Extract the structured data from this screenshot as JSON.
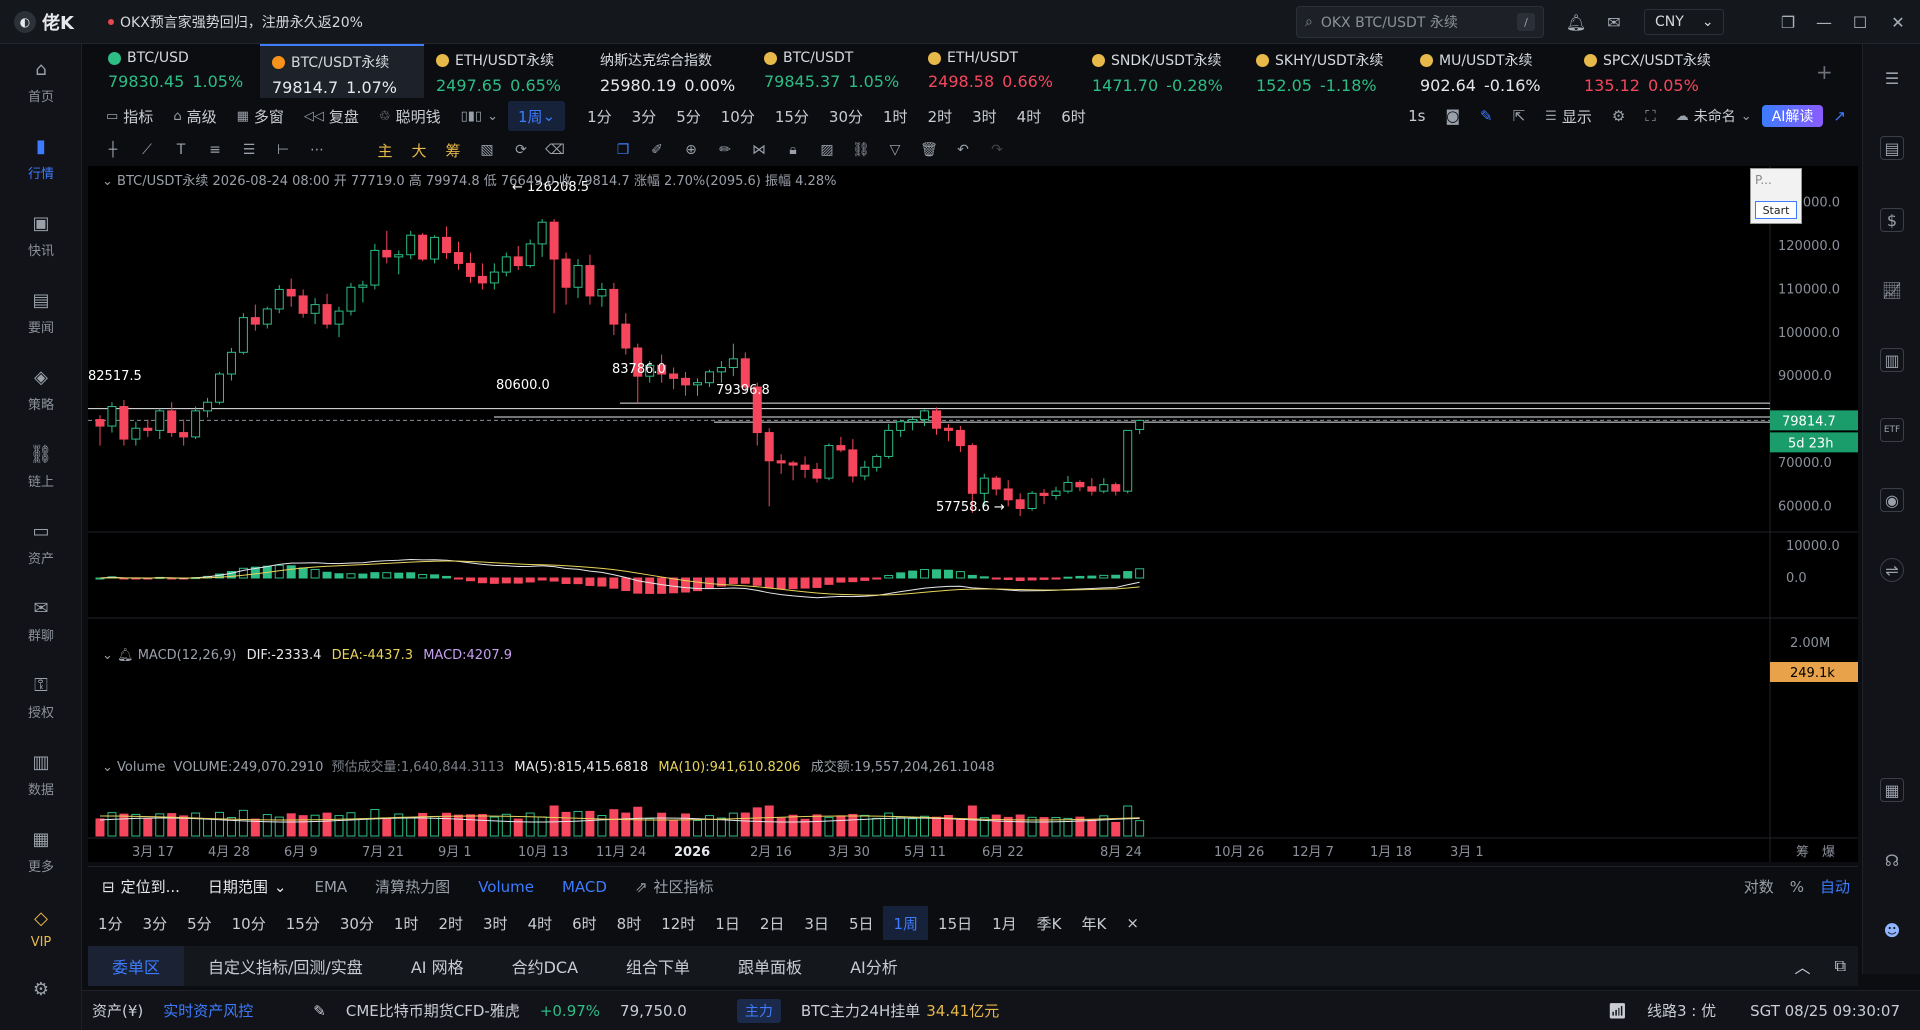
{
  "app": {
    "name": "佬K"
  },
  "announcement": "OKX预言家强势回归，注册永久返20%",
  "search": {
    "placeholder": "OKX BTC/USDT 永续",
    "shortcut": "/"
  },
  "currency": "CNY",
  "sidebar": [
    {
      "label": "首页",
      "icon": "home-icon"
    },
    {
      "label": "行情",
      "icon": "chart-bars-icon",
      "active": true
    },
    {
      "label": "快讯",
      "icon": "news-icon"
    },
    {
      "label": "要闻",
      "icon": "article-icon"
    },
    {
      "label": "策略",
      "icon": "robot-icon"
    },
    {
      "label": "链上",
      "icon": "chain-icon"
    },
    {
      "label": "资产",
      "icon": "wallet-icon"
    },
    {
      "label": "群聊",
      "icon": "chat-icon"
    },
    {
      "label": "授权",
      "icon": "key-icon"
    },
    {
      "label": "数据",
      "icon": "data-icon"
    },
    {
      "label": "更多",
      "icon": "grid-icon"
    },
    {
      "label": "VIP",
      "icon": "vip-icon",
      "vip": true
    }
  ],
  "tickers": [
    {
      "name": "BTC/USD",
      "price": "79830.45",
      "change": "1.05%",
      "color": "#2ebd85",
      "coin": "#2ebd85",
      "dir": "up"
    },
    {
      "name": "BTC/USDT永续",
      "price": "79814.7",
      "change": "1.07%",
      "color": "#f7931a",
      "coin": "#f7931a",
      "dir": "white",
      "active": true
    },
    {
      "name": "ETH/USDT永续",
      "price": "2497.65",
      "change": "0.65%",
      "coin": "#e7b84a",
      "dir": "up"
    },
    {
      "name": "纳斯达克综合指数",
      "price": "25980.19",
      "change": "0.00%",
      "coin": "",
      "dir": "white"
    },
    {
      "name": "BTC/USDT",
      "price": "79845.37",
      "change": "1.05%",
      "coin": "#e7b84a",
      "dir": "up"
    },
    {
      "name": "ETH/USDT",
      "price": "2498.58",
      "change": "0.66%",
      "coin": "#e7b84a",
      "dir": "down"
    },
    {
      "name": "SNDK/USDT永续",
      "price": "1471.70",
      "change": "-0.28%",
      "coin": "#e7b84a",
      "dir": "up"
    },
    {
      "name": "SKHY/USDT永续",
      "price": "152.05",
      "change": "-1.18%",
      "coin": "#e7b84a",
      "dir": "up"
    },
    {
      "name": "MU/USDT永续",
      "price": "902.64",
      "change": "-0.16%",
      "coin": "#e7b84a",
      "dir": "white"
    },
    {
      "name": "SPCX/USDT永续",
      "price": "135.12",
      "change": "0.05%",
      "coin": "#e7b84a",
      "dir": "down"
    }
  ],
  "toolbar1": {
    "items": [
      "指标",
      "高级",
      "多窗",
      "复盘",
      "聪明钱"
    ],
    "interval": "1周",
    "timeframes": [
      "1分",
      "3分",
      "5分",
      "10分",
      "15分",
      "30分",
      "1时",
      "2时",
      "3时",
      "4时",
      "6时"
    ],
    "right_1s": "1s",
    "display": "显示",
    "layout_name": "未命名",
    "ai_label": "AI解读"
  },
  "toolbar2": {
    "text_tools": [
      "主",
      "大",
      "筹"
    ]
  },
  "chart": {
    "info": "BTC/USDT永续 2026-08-24 08:00 开 77719.0 高 79974.8 低 76649.0 收 79814.7 涨幅 2.70%(2095.6) 振幅 4.28%",
    "macd_label": "MACD(12,26,9)",
    "macd_dif": "DIF:-2333.4",
    "macd_dea": "DEA:-4437.3",
    "macd_val": "MACD:4207.9",
    "vol_label": "Volume",
    "vol_value": "VOLUME:249,070.2910",
    "vol_est": "预估成交量:1,640,844.3113",
    "vol_ma5": "MA(5):815,415.6818",
    "vol_ma10": "MA(10):941,610.8206",
    "vol_turnover": "成交额:19,557,204,261.1048",
    "price_labels": [
      "130000.0",
      "120000.0",
      "110000.0",
      "100000.0",
      "90000.0",
      "70000.0",
      "60000.0"
    ],
    "macd_axis": [
      "10000.0",
      "0.0"
    ],
    "vol_axis": [
      "2.00M"
    ],
    "current_price": "79814.7",
    "countdown": "5d 23h",
    "vol_current": "249.1k",
    "annotations": [
      "← 126208.5",
      "82517.5",
      "80600.0",
      "83786.0",
      "79396.8",
      "57758.6 →"
    ],
    "x_labels": [
      "3月 17",
      "4月 28",
      "6月 9",
      "7月 21",
      "9月 1",
      "10月 13",
      "11月 24",
      "2026",
      "2月 16",
      "3月 30",
      "5月 11",
      "6月 22",
      "8月 24",
      "10月 26",
      "12月 7",
      "1月 18",
      "3月 1"
    ],
    "x_right": [
      "筹",
      "爆"
    ],
    "popup_text": "P...",
    "popup_button": "Start"
  },
  "chart_data": {
    "type": "candlestick",
    "interval": "1周",
    "ylim": [
      55000,
      132000
    ],
    "candles": [
      [
        80000,
        81000,
        74000,
        78500
      ],
      [
        78500,
        84000,
        77000,
        83000
      ],
      [
        83000,
        84500,
        74000,
        75500
      ],
      [
        75500,
        79500,
        74000,
        78000
      ],
      [
        78000,
        80000,
        76000,
        77500
      ],
      [
        77500,
        82500,
        75500,
        82000
      ],
      [
        82000,
        84000,
        76000,
        77000
      ],
      [
        77000,
        80000,
        74000,
        76000
      ],
      [
        76000,
        83000,
        75500,
        82000
      ],
      [
        82000,
        85000,
        80500,
        84000
      ],
      [
        84000,
        91000,
        83500,
        90500
      ],
      [
        90500,
        96500,
        89000,
        95500
      ],
      [
        95500,
        104500,
        95000,
        103500
      ],
      [
        103500,
        106500,
        100500,
        102000
      ],
      [
        102000,
        106000,
        101000,
        105500
      ],
      [
        105500,
        111000,
        104500,
        110000
      ],
      [
        110000,
        112500,
        106000,
        108500
      ],
      [
        108500,
        110000,
        103500,
        104500
      ],
      [
        104500,
        108000,
        102000,
        106500
      ],
      [
        106500,
        109000,
        101000,
        102000
      ],
      [
        102000,
        106000,
        99000,
        105000
      ],
      [
        105000,
        111500,
        104000,
        110500
      ],
      [
        110500,
        112000,
        107000,
        111000
      ],
      [
        111000,
        120500,
        110000,
        119000
      ],
      [
        119000,
        123500,
        116000,
        117500
      ],
      [
        117500,
        119000,
        113500,
        118000
      ],
      [
        118000,
        123500,
        117000,
        122500
      ],
      [
        122500,
        123000,
        116500,
        117000
      ],
      [
        117000,
        122500,
        116000,
        122000
      ],
      [
        122000,
        124500,
        117000,
        118500
      ],
      [
        118500,
        121000,
        114500,
        116000
      ],
      [
        116000,
        118500,
        111500,
        113000
      ],
      [
        113000,
        116000,
        110000,
        111500
      ],
      [
        111500,
        116000,
        110000,
        114000
      ],
      [
        114000,
        118500,
        113000,
        117500
      ],
      [
        117500,
        120000,
        114500,
        115500
      ],
      [
        115500,
        121500,
        115000,
        120500
      ],
      [
        120500,
        126208.5,
        117500,
        125500
      ],
      [
        125500,
        126200,
        104500,
        117000
      ],
      [
        117000,
        118500,
        106500,
        110500
      ],
      [
        110500,
        117000,
        108000,
        115500
      ],
      [
        115500,
        118000,
        106500,
        108500
      ],
      [
        108500,
        111500,
        106000,
        110000
      ],
      [
        110000,
        111500,
        99500,
        102000
      ],
      [
        102000,
        104500,
        95000,
        96500
      ],
      [
        96500,
        97500,
        83786,
        90000
      ],
      [
        90000,
        93500,
        88500,
        92500
      ],
      [
        92500,
        95000,
        88500,
        90500
      ],
      [
        90500,
        92000,
        87000,
        89500
      ],
      [
        89500,
        91000,
        85500,
        88000
      ],
      [
        88000,
        89500,
        85500,
        88500
      ],
      [
        88500,
        91500,
        87500,
        91000
      ],
      [
        91000,
        93500,
        88500,
        92000
      ],
      [
        92000,
        97500,
        90000,
        94000
      ],
      [
        94000,
        95500,
        86500,
        87500
      ],
      [
        87500,
        88500,
        74000,
        77000
      ],
      [
        77000,
        78000,
        60000,
        70500
      ],
      [
        70500,
        72000,
        67500,
        70000
      ],
      [
        70000,
        70500,
        66000,
        69500
      ],
      [
        69500,
        71500,
        66500,
        68500
      ],
      [
        68500,
        70000,
        65500,
        66500
      ],
      [
        66500,
        74500,
        66000,
        74000
      ],
      [
        74000,
        76000,
        72500,
        73000
      ],
      [
        73000,
        75500,
        65500,
        67000
      ],
      [
        67000,
        70500,
        66000,
        69000
      ],
      [
        69000,
        72000,
        68000,
        71500
      ],
      [
        71500,
        79000,
        71000,
        77500
      ],
      [
        77500,
        80000,
        76000,
        79500
      ],
      [
        79500,
        80500,
        77500,
        80000
      ],
      [
        80000,
        82300,
        78500,
        82000
      ],
      [
        82000,
        82800,
        76500,
        78000
      ],
      [
        78000,
        79000,
        75000,
        77500
      ],
      [
        77500,
        78500,
        72500,
        74000
      ],
      [
        74000,
        74500,
        58500,
        63000
      ],
      [
        63000,
        67500,
        60000,
        66500
      ],
      [
        66500,
        67000,
        62500,
        64000
      ],
      [
        64000,
        66000,
        60000,
        61500
      ],
      [
        61500,
        63000,
        57758.6,
        59500
      ],
      [
        59500,
        63500,
        59000,
        63000
      ],
      [
        63000,
        64000,
        60500,
        62500
      ],
      [
        62500,
        64500,
        61500,
        63500
      ],
      [
        63500,
        67000,
        63000,
        65500
      ],
      [
        65500,
        66000,
        63500,
        64500
      ],
      [
        64500,
        66500,
        62500,
        63500
      ],
      [
        63500,
        66500,
        63000,
        65000
      ],
      [
        65000,
        65500,
        62500,
        63500
      ],
      [
        63500,
        77500,
        63000,
        77500
      ],
      [
        77719,
        79974.8,
        76649,
        79814.7
      ]
    ],
    "macd_hist_first_green_index": 57,
    "horizontal_levels": [
      82517.5,
      80600.0,
      83786.0,
      79396.8
    ],
    "current_price": 79814.7
  },
  "rangebar": {
    "locate": "定位到...",
    "date_range": "日期范围",
    "indicators": [
      "EMA",
      "清算热力图"
    ],
    "active_indicators": [
      "Volume",
      "MACD"
    ],
    "community": "社区指标",
    "right": [
      "对数",
      "%",
      "自动"
    ]
  },
  "periodbar": [
    "1分",
    "3分",
    "5分",
    "10分",
    "15分",
    "30分",
    "1时",
    "2时",
    "3时",
    "4时",
    "6时",
    "8时",
    "12时",
    "1日",
    "2日",
    "3日",
    "5日",
    "1周",
    "15日",
    "1月",
    "季K",
    "年K"
  ],
  "periodbar_active": "1周",
  "paneltabs": [
    "委单区",
    "自定义指标/回测/实盘",
    "AI 网格",
    "合约DCA",
    "组合下单",
    "跟单面板",
    "AI分析"
  ],
  "statusbar": {
    "assets": "资产(¥)",
    "risk": "实时资产风控",
    "cme": "CME比特币期货CFD-雅虎",
    "cme_change": "+0.97%",
    "cme_price": "79,750.0",
    "main_tag": "主力",
    "main_text": "BTC主力24H挂单",
    "main_value": "34.41亿元",
    "line": "线路3 : 优",
    "time": "SGT 08/25 09:30:07"
  },
  "colors": {
    "up": "#2ebd85",
    "down": "#f6465d",
    "accent": "#3d7cff",
    "gold": "#e7b84a"
  }
}
